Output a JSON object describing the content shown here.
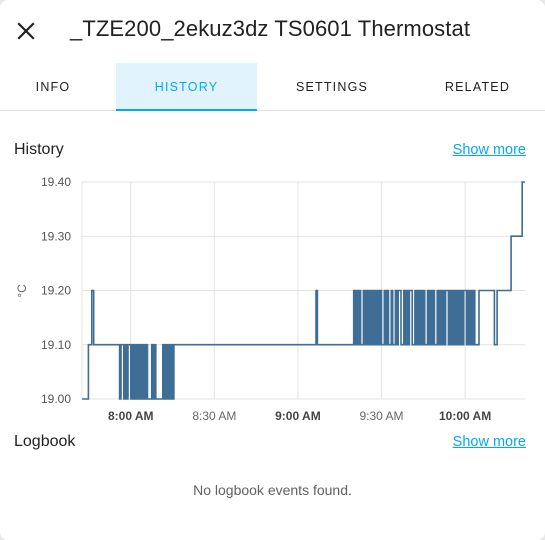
{
  "dialog": {
    "title": "_TZE200_2ekuz3dz TS0601 Thermostat",
    "close_icon": "close-icon"
  },
  "tabs": [
    {
      "label": "INFO",
      "active": false
    },
    {
      "label": "HISTORY",
      "active": true
    },
    {
      "label": "SETTINGS",
      "active": false
    },
    {
      "label": "RELATED",
      "active": false
    }
  ],
  "history": {
    "title": "History",
    "show_more": "Show more"
  },
  "logbook": {
    "title": "Logbook",
    "show_more": "Show more",
    "empty_message": "No logbook events found."
  },
  "colors": {
    "accent": "#03a9f4",
    "line": "#3e6d96",
    "grid": "#e3e3e3"
  },
  "chart_data": {
    "type": "line",
    "step": true,
    "ylabel": "°C",
    "ylim": [
      19.0,
      19.4
    ],
    "yticks": [
      "19.00",
      "19.10",
      "19.20",
      "19.30",
      "19.40"
    ],
    "xticks": [
      {
        "label": "8:00 AM",
        "bold": true,
        "t": 480
      },
      {
        "label": "8:30 AM",
        "bold": false,
        "t": 510
      },
      {
        "label": "9:00 AM",
        "bold": true,
        "t": 540
      },
      {
        "label": "9:30 AM",
        "bold": false,
        "t": 570
      },
      {
        "label": "10:00 AM",
        "bold": true,
        "t": 600
      }
    ],
    "xlim": [
      462.5,
      621.5
    ],
    "grid": true,
    "series": [
      {
        "x": [
          462.5,
          464.8,
          466.0,
          466.7,
          469.0,
          470.5,
          476.0,
          476.5,
          477.5,
          478.0,
          478.5,
          479.0,
          480.0,
          480.5,
          481.0,
          481.5,
          482.0,
          482.5,
          483.0,
          483.5,
          484.0,
          484.5,
          485.0,
          485.5,
          486.0,
          487.5,
          488.0,
          488.5,
          489.0,
          491.5,
          492.0,
          492.5,
          493.0,
          493.5,
          494.0,
          494.5,
          495.0,
          495.5,
          496.0,
          546.5,
          547.0,
          560.0,
          560.5,
          561.0,
          561.5,
          562.0,
          562.5,
          563.5,
          564.0,
          564.5,
          565.0,
          565.5,
          566.0,
          566.5,
          567.0,
          567.5,
          568.0,
          568.5,
          569.0,
          569.5,
          570.0,
          571.0,
          571.5,
          572.0,
          572.5,
          573.5,
          574.0,
          575.0,
          575.5,
          576.0,
          577.0,
          578.0,
          578.5,
          579.0,
          579.5,
          580.0,
          581.0,
          582.0,
          582.5,
          583.0,
          583.5,
          584.0,
          584.5,
          585.0,
          585.5,
          586.5,
          587.0,
          587.5,
          588.0,
          588.5,
          589.0,
          590.0,
          590.5,
          591.0,
          591.5,
          592.0,
          592.5,
          593.0,
          594.0,
          594.5,
          595.0,
          595.5,
          596.0,
          596.5,
          597.0,
          597.5,
          598.0,
          598.5,
          599.0,
          599.5,
          600.5,
          601.0,
          601.5,
          602.0,
          602.5,
          603.0,
          603.5,
          605.0,
          610.5,
          611.5,
          615.0,
          616.5,
          617.5,
          620.5,
          621.5
        ],
        "y": [
          19.0,
          19.1,
          19.2,
          19.1,
          19.1,
          19.1,
          19.0,
          19.1,
          19.0,
          19.1,
          19.0,
          19.1,
          19.0,
          19.1,
          19.0,
          19.1,
          19.0,
          19.1,
          19.0,
          19.1,
          19.0,
          19.1,
          19.0,
          19.1,
          19.0,
          19.1,
          19.0,
          19.1,
          19.0,
          19.1,
          19.0,
          19.1,
          19.0,
          19.1,
          19.0,
          19.1,
          19.0,
          19.1,
          19.1,
          19.2,
          19.1,
          19.2,
          19.1,
          19.2,
          19.1,
          19.2,
          19.1,
          19.2,
          19.1,
          19.2,
          19.1,
          19.2,
          19.1,
          19.2,
          19.1,
          19.2,
          19.1,
          19.2,
          19.1,
          19.2,
          19.1,
          19.2,
          19.1,
          19.2,
          19.1,
          19.2,
          19.1,
          19.2,
          19.1,
          19.2,
          19.1,
          19.2,
          19.1,
          19.2,
          19.1,
          19.2,
          19.1,
          19.2,
          19.1,
          19.2,
          19.1,
          19.2,
          19.1,
          19.2,
          19.1,
          19.2,
          19.1,
          19.2,
          19.1,
          19.2,
          19.1,
          19.2,
          19.1,
          19.2,
          19.1,
          19.2,
          19.1,
          19.2,
          19.1,
          19.2,
          19.1,
          19.2,
          19.1,
          19.2,
          19.1,
          19.2,
          19.1,
          19.2,
          19.1,
          19.2,
          19.1,
          19.2,
          19.1,
          19.2,
          19.1,
          19.2,
          19.1,
          19.2,
          19.1,
          19.2,
          19.2,
          19.3,
          19.3,
          19.4,
          19.4
        ]
      }
    ]
  }
}
